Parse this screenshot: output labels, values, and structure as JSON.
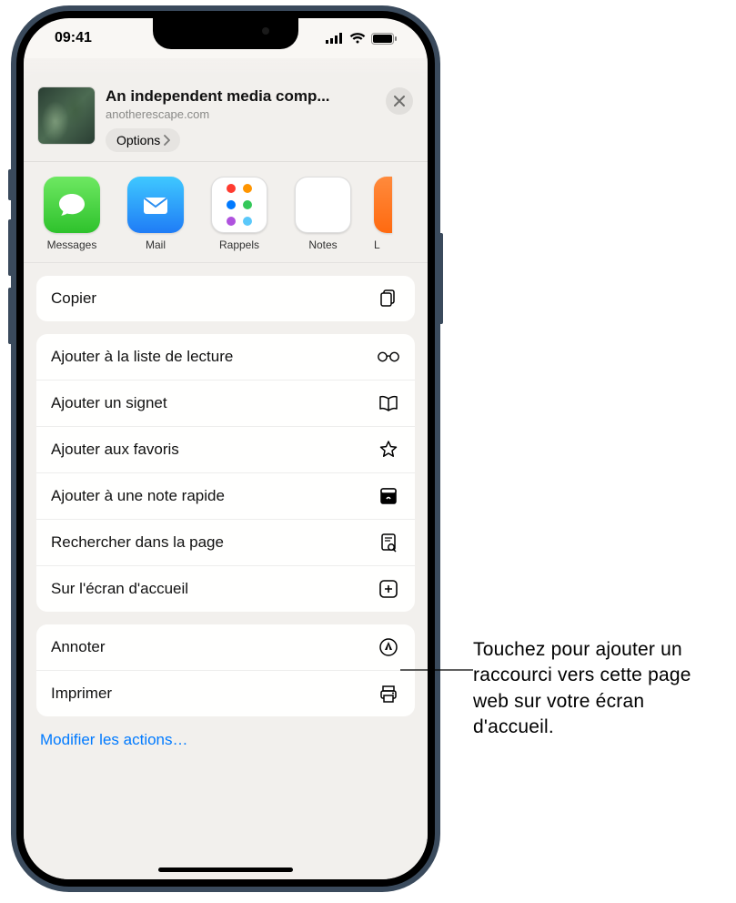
{
  "status": {
    "time": "09:41"
  },
  "sheet": {
    "title": "An independent media comp...",
    "subtitle": "anotherescape.com",
    "options_label": "Options"
  },
  "apps": [
    {
      "id": "messages",
      "label": "Messages"
    },
    {
      "id": "mail",
      "label": "Mail"
    },
    {
      "id": "reminders",
      "label": "Rappels"
    },
    {
      "id": "notes",
      "label": "Notes"
    },
    {
      "id": "partial",
      "label": "L"
    }
  ],
  "actions": {
    "copy": "Copier",
    "reading_list": "Ajouter à la liste de lecture",
    "bookmark": "Ajouter un signet",
    "favorites": "Ajouter aux favoris",
    "quick_note": "Ajouter à une note rapide",
    "find": "Rechercher dans la page",
    "home_screen": "Sur l'écran d'accueil",
    "markup": "Annoter",
    "print": "Imprimer"
  },
  "edit_actions": "Modifier les actions…",
  "callout": "Touchez pour ajouter un raccourci vers cette page web sur votre écran d'accueil."
}
